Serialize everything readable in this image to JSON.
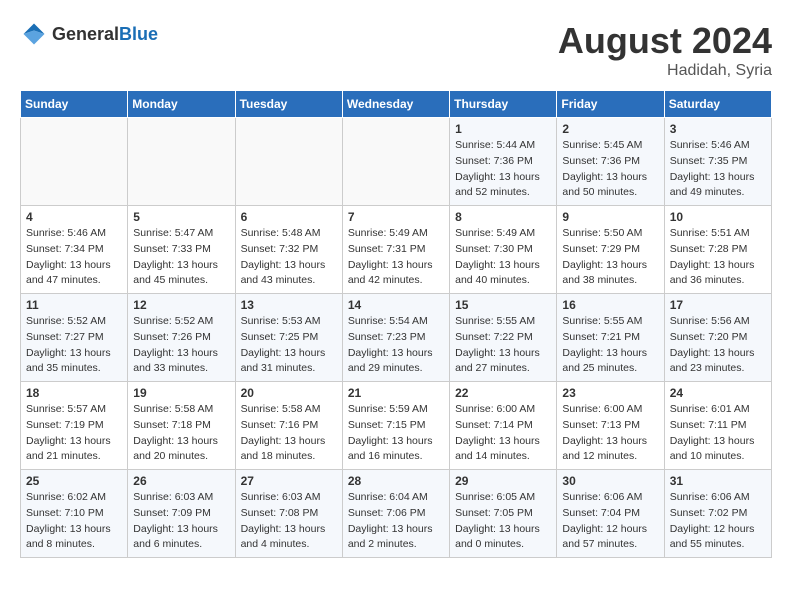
{
  "header": {
    "logo_general": "General",
    "logo_blue": "Blue",
    "month_year": "August 2024",
    "location": "Hadidah, Syria"
  },
  "calendar": {
    "days_of_week": [
      "Sunday",
      "Monday",
      "Tuesday",
      "Wednesday",
      "Thursday",
      "Friday",
      "Saturday"
    ],
    "weeks": [
      [
        {
          "day": "",
          "info": ""
        },
        {
          "day": "",
          "info": ""
        },
        {
          "day": "",
          "info": ""
        },
        {
          "day": "",
          "info": ""
        },
        {
          "day": "1",
          "info": "Sunrise: 5:44 AM\nSunset: 7:36 PM\nDaylight: 13 hours\nand 52 minutes."
        },
        {
          "day": "2",
          "info": "Sunrise: 5:45 AM\nSunset: 7:36 PM\nDaylight: 13 hours\nand 50 minutes."
        },
        {
          "day": "3",
          "info": "Sunrise: 5:46 AM\nSunset: 7:35 PM\nDaylight: 13 hours\nand 49 minutes."
        }
      ],
      [
        {
          "day": "4",
          "info": "Sunrise: 5:46 AM\nSunset: 7:34 PM\nDaylight: 13 hours\nand 47 minutes."
        },
        {
          "day": "5",
          "info": "Sunrise: 5:47 AM\nSunset: 7:33 PM\nDaylight: 13 hours\nand 45 minutes."
        },
        {
          "day": "6",
          "info": "Sunrise: 5:48 AM\nSunset: 7:32 PM\nDaylight: 13 hours\nand 43 minutes."
        },
        {
          "day": "7",
          "info": "Sunrise: 5:49 AM\nSunset: 7:31 PM\nDaylight: 13 hours\nand 42 minutes."
        },
        {
          "day": "8",
          "info": "Sunrise: 5:49 AM\nSunset: 7:30 PM\nDaylight: 13 hours\nand 40 minutes."
        },
        {
          "day": "9",
          "info": "Sunrise: 5:50 AM\nSunset: 7:29 PM\nDaylight: 13 hours\nand 38 minutes."
        },
        {
          "day": "10",
          "info": "Sunrise: 5:51 AM\nSunset: 7:28 PM\nDaylight: 13 hours\nand 36 minutes."
        }
      ],
      [
        {
          "day": "11",
          "info": "Sunrise: 5:52 AM\nSunset: 7:27 PM\nDaylight: 13 hours\nand 35 minutes."
        },
        {
          "day": "12",
          "info": "Sunrise: 5:52 AM\nSunset: 7:26 PM\nDaylight: 13 hours\nand 33 minutes."
        },
        {
          "day": "13",
          "info": "Sunrise: 5:53 AM\nSunset: 7:25 PM\nDaylight: 13 hours\nand 31 minutes."
        },
        {
          "day": "14",
          "info": "Sunrise: 5:54 AM\nSunset: 7:23 PM\nDaylight: 13 hours\nand 29 minutes."
        },
        {
          "day": "15",
          "info": "Sunrise: 5:55 AM\nSunset: 7:22 PM\nDaylight: 13 hours\nand 27 minutes."
        },
        {
          "day": "16",
          "info": "Sunrise: 5:55 AM\nSunset: 7:21 PM\nDaylight: 13 hours\nand 25 minutes."
        },
        {
          "day": "17",
          "info": "Sunrise: 5:56 AM\nSunset: 7:20 PM\nDaylight: 13 hours\nand 23 minutes."
        }
      ],
      [
        {
          "day": "18",
          "info": "Sunrise: 5:57 AM\nSunset: 7:19 PM\nDaylight: 13 hours\nand 21 minutes."
        },
        {
          "day": "19",
          "info": "Sunrise: 5:58 AM\nSunset: 7:18 PM\nDaylight: 13 hours\nand 20 minutes."
        },
        {
          "day": "20",
          "info": "Sunrise: 5:58 AM\nSunset: 7:16 PM\nDaylight: 13 hours\nand 18 minutes."
        },
        {
          "day": "21",
          "info": "Sunrise: 5:59 AM\nSunset: 7:15 PM\nDaylight: 13 hours\nand 16 minutes."
        },
        {
          "day": "22",
          "info": "Sunrise: 6:00 AM\nSunset: 7:14 PM\nDaylight: 13 hours\nand 14 minutes."
        },
        {
          "day": "23",
          "info": "Sunrise: 6:00 AM\nSunset: 7:13 PM\nDaylight: 13 hours\nand 12 minutes."
        },
        {
          "day": "24",
          "info": "Sunrise: 6:01 AM\nSunset: 7:11 PM\nDaylight: 13 hours\nand 10 minutes."
        }
      ],
      [
        {
          "day": "25",
          "info": "Sunrise: 6:02 AM\nSunset: 7:10 PM\nDaylight: 13 hours\nand 8 minutes."
        },
        {
          "day": "26",
          "info": "Sunrise: 6:03 AM\nSunset: 7:09 PM\nDaylight: 13 hours\nand 6 minutes."
        },
        {
          "day": "27",
          "info": "Sunrise: 6:03 AM\nSunset: 7:08 PM\nDaylight: 13 hours\nand 4 minutes."
        },
        {
          "day": "28",
          "info": "Sunrise: 6:04 AM\nSunset: 7:06 PM\nDaylight: 13 hours\nand 2 minutes."
        },
        {
          "day": "29",
          "info": "Sunrise: 6:05 AM\nSunset: 7:05 PM\nDaylight: 13 hours\nand 0 minutes."
        },
        {
          "day": "30",
          "info": "Sunrise: 6:06 AM\nSunset: 7:04 PM\nDaylight: 12 hours\nand 57 minutes."
        },
        {
          "day": "31",
          "info": "Sunrise: 6:06 AM\nSunset: 7:02 PM\nDaylight: 12 hours\nand 55 minutes."
        }
      ]
    ]
  }
}
